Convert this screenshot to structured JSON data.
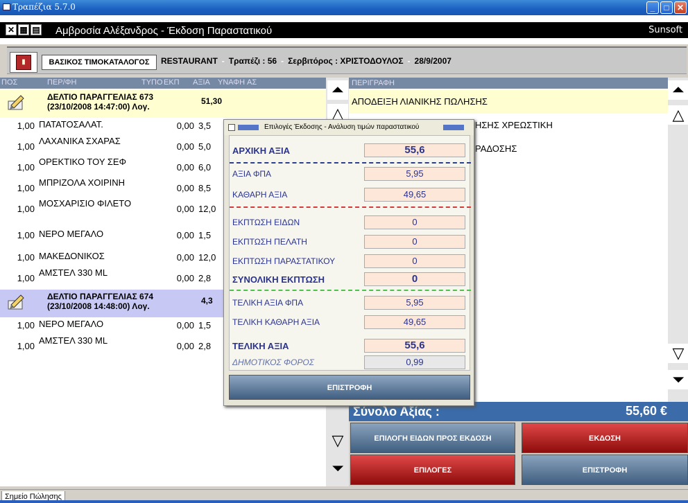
{
  "window": {
    "title": "Τραπέζια 5.7.0"
  },
  "app_header": {
    "document_title": "Αμβροσία Αλέξανδρος - Έκδοση Παραστατικού",
    "brand": "Sunsoft"
  },
  "info_bar": {
    "catalog_label": "ΒΑΣΙΚΟΣ ΤΙΜΟΚΑΤΑΛΟΓΟΣ",
    "venue": "RESTAURANT",
    "table": "Τραπέζι : 56",
    "waiter": "Σερβιτόρος : ΧΡΙΣΤΟΔΟΥΛΟΣ",
    "date": "28/9/2007"
  },
  "left_table": {
    "headers": [
      "ΠΟΣ",
      "ΠΕΡ/ΦΗ",
      "ΤΥΠΟ",
      "ΕΚΠ",
      "ΑΞΙΑ",
      "ΥΝΑΦΗ",
      "ΑΣ"
    ],
    "order1": {
      "title": "ΔΕΛΤΙΟ ΠΑΡΑΓΓΕΛΙΑΣ 673",
      "subtitle": "(23/10/2008 14:47:00) Λογ.",
      "value": "51,30"
    },
    "rows1": [
      {
        "q": "1,00",
        "d": "ΠΑΤΑΤΟΣΑΛΑΤ.",
        "e": "0,00",
        "v": "3,5"
      },
      {
        "q": "1,00",
        "d": "ΛΑΧΑΝΙΚΑ ΣΧΑΡΑΣ",
        "e": "0,00",
        "v": "5,0"
      },
      {
        "q": "1,00",
        "d": "ΟΡΕΚΤΙΚΟ ΤΟΥ ΣΕΦ",
        "e": "0,00",
        "v": "6,0"
      },
      {
        "q": "1,00",
        "d": "ΜΠΡΙΖΟΛΑ ΧΟΙΡΙΝΗ",
        "e": "0,00",
        "v": "8,5"
      },
      {
        "q": "1,00",
        "d": "ΜΟΣΧΑΡΙΣΙΟ ΦΙΛΕΤΟ",
        "e": "0,00",
        "v": "12,0"
      },
      {
        "q": "1,00",
        "d": "ΝΕΡΟ ΜΕΓΑΛΟ",
        "e": "0,00",
        "v": "1,5"
      },
      {
        "q": "1,00",
        "d": "ΜΑΚΕΔΟΝΙΚΟΣ",
        "e": "0,00",
        "v": "12,0"
      },
      {
        "q": "1,00",
        "d": "ΑΜΣΤΕΛ 330 ML",
        "e": "0,00",
        "v": "2,8"
      }
    ],
    "order2": {
      "title": "ΔΕΛΤΙΟ ΠΑΡΑΓΓΕΛΙΑΣ 674",
      "subtitle": "(23/10/2008 14:48:00) Λογ.",
      "value": "4,3"
    },
    "rows2": [
      {
        "q": "1,00",
        "d": "ΝΕΡΟ ΜΕΓΑΛΟ",
        "e": "0,00",
        "v": "1,5"
      },
      {
        "q": "1,00",
        "d": "ΑΜΣΤΕΛ 330 ML",
        "e": "0,00",
        "v": "2,8"
      }
    ]
  },
  "right_table": {
    "header": "ΠΕΡΙΓΡΑΦΗ",
    "rows": [
      "ΑΠΟΔΕΙΞΗ ΛΙΑΝΙΚΗΣ ΠΩΛΗΣΗΣ",
      "ΗΣΗΣ ΧΡΕΩΣΤΙΚΗ",
      "ΡΑΔΟΣΗΣ"
    ]
  },
  "total": {
    "label": "Σύνολο Αξίας :",
    "value": "55,60 €"
  },
  "buttons": {
    "select_items": "ΕΠΙΛΟΓΗ ΕΙΔΩΝ ΠΡΟΣ ΕΚΔΟΣΗ",
    "issue": "ΕΚΔΟΣΗ",
    "options": "ΕΠΙΛΟΓΕΣ",
    "back": "ΕΠΙΣΤΡΟΦΗ"
  },
  "dialog": {
    "title": "Επιλογές Έκδοσης - Ανάλυση τιμών παραστατικού",
    "initial_value_label": "ΑΡΧΙΚΗ ΑΞΙΑ",
    "initial_value": "55,6",
    "vat_label": "ΑΞΙΑ ΦΠΑ",
    "vat": "5,95",
    "net_label": "ΚΑΘΑΡΗ ΑΞΙΑ",
    "net": "49,65",
    "disc_items_label": "ΕΚΠΤΩΣΗ ΕΙΔΩΝ",
    "disc_items": "0",
    "disc_customer_label": "ΕΚΠΤΩΣΗ ΠΕΛΑΤΗ",
    "disc_customer": "0",
    "disc_doc_label": "ΕΚΠΤΩΣΗ ΠΑΡΑΣΤΑΤΙΚΟΥ",
    "disc_doc": "0",
    "disc_total_label": "ΣΥΝΟΛΙΚΗ ΕΚΠΤΩΣΗ",
    "disc_total": "0",
    "final_vat_label": "ΤΕΛΙΚΗ ΑΞΙΑ ΦΠΑ",
    "final_vat": "5,95",
    "final_net_label": "ΤΕΛΙΚΗ ΚΑΘΑΡΗ ΑΞΙΑ",
    "final_net": "49,65",
    "final_value_label": "ΤΕΛΙΚΗ ΑΞΙΑ",
    "final_value": "55,6",
    "municipal_tax_label": "ΔΗΜΟΤΙΚΟΣ ΦΟΡΟΣ",
    "municipal_tax": "0,99",
    "back_label": "ΕΠΙΣΤΡΟΦΗ"
  },
  "status": {
    "tab": "Σημείο Πώλησης"
  },
  "colors": {
    "header_blue": "#7689a4",
    "highlight_yellow": "#fffed0",
    "highlight_lavender": "#c8c8f4",
    "red_button": "#c21a1a",
    "total_bar": "#3b6ba8"
  }
}
